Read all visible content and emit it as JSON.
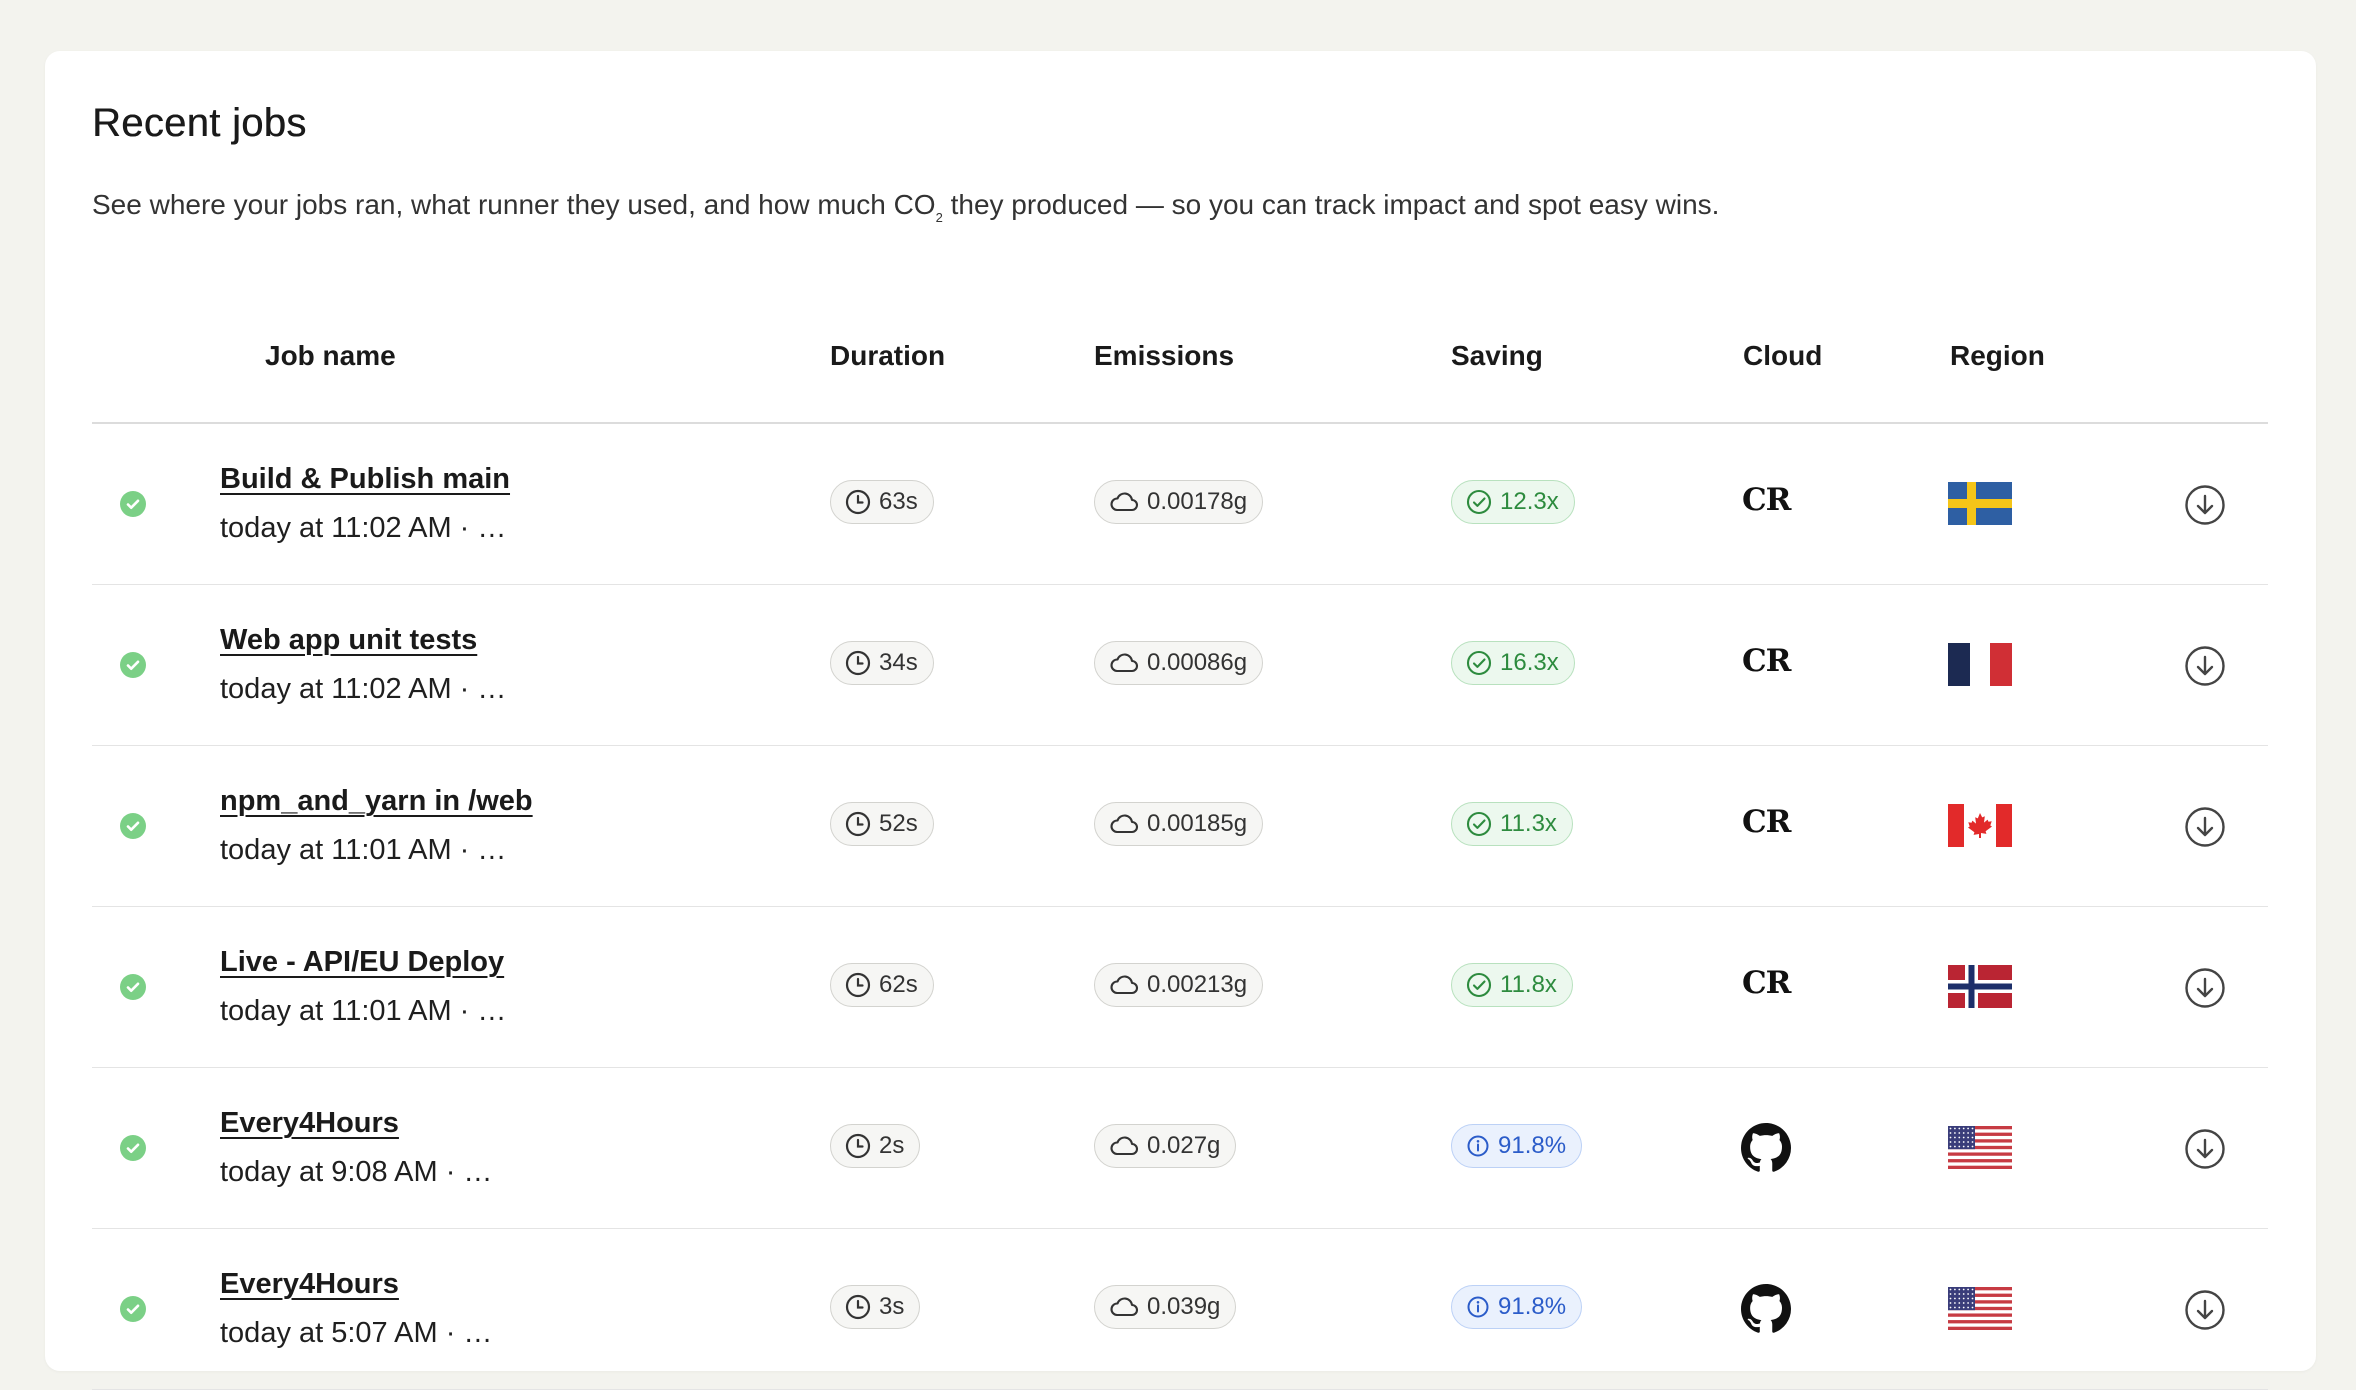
{
  "header": {
    "title": "Recent jobs",
    "subtitle_before": "See where your jobs ran, what runner they used, and how much CO",
    "subtitle_sub": "2",
    "subtitle_after": " they produced — so you can track impact and spot easy wins."
  },
  "columns": {
    "job_name": "Job name",
    "duration": "Duration",
    "emissions": "Emissions",
    "saving": "Saving",
    "cloud": "Cloud",
    "region": "Region"
  },
  "rows": [
    {
      "name": "Build & Publish main",
      "meta": "today at 11:02 AM · …",
      "duration": "63s",
      "emissions": "0.00178g",
      "saving": "12.3x",
      "saving_type": "check",
      "cloud": "CR",
      "cloud_icon": "cr-logo-icon",
      "region_flag": "sweden-flag-icon",
      "status": "success"
    },
    {
      "name": "Web app unit tests",
      "meta": "today at 11:02 AM · …",
      "duration": "34s",
      "emissions": "0.00086g",
      "saving": "16.3x",
      "saving_type": "check",
      "cloud": "CR",
      "cloud_icon": "cr-logo-icon",
      "region_flag": "france-flag-icon",
      "status": "success"
    },
    {
      "name": "npm_and_yarn in /web",
      "meta": "today at 11:01 AM · …",
      "duration": "52s",
      "emissions": "0.00185g",
      "saving": "11.3x",
      "saving_type": "check",
      "cloud": "CR",
      "cloud_icon": "cr-logo-icon",
      "region_flag": "canada-flag-icon",
      "status": "success"
    },
    {
      "name": "Live - API/EU Deploy",
      "meta": "today at 11:01 AM · …",
      "duration": "62s",
      "emissions": "0.00213g",
      "saving": "11.8x",
      "saving_type": "check",
      "cloud": "CR",
      "cloud_icon": "cr-logo-icon",
      "region_flag": "norway-flag-icon",
      "status": "success"
    },
    {
      "name": "Every4Hours",
      "meta": "today at 9:08 AM · …",
      "duration": "2s",
      "emissions": "0.027g",
      "saving": "91.8%",
      "saving_type": "info",
      "cloud": "",
      "cloud_icon": "github-icon",
      "region_flag": "usa-flag-icon",
      "status": "success"
    },
    {
      "name": "Every4Hours",
      "meta": "today at 5:07 AM · …",
      "duration": "3s",
      "emissions": "0.039g",
      "saving": "91.8%",
      "saving_type": "info",
      "cloud": "",
      "cloud_icon": "github-icon",
      "region_flag": "usa-flag-icon",
      "status": "success"
    }
  ],
  "colors": {
    "success_dot": "#7bd086",
    "saving_green": "#2d8b3e",
    "saving_blue": "#2b5cc9"
  }
}
